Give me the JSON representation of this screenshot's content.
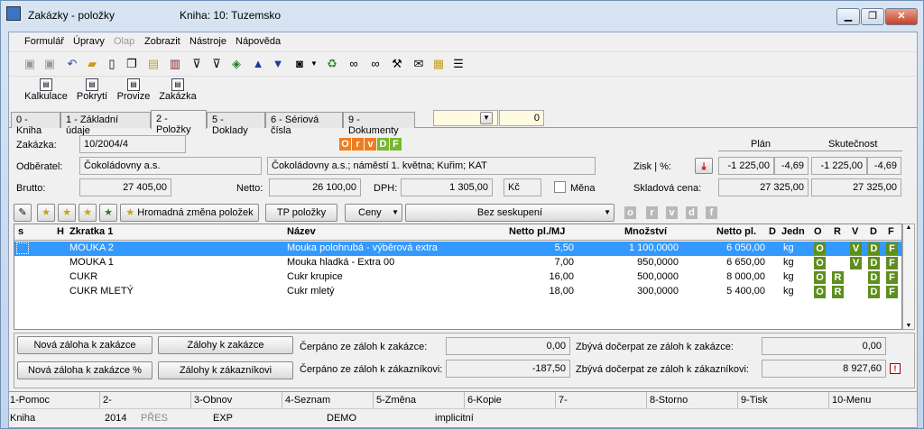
{
  "title": {
    "window": "Zakázky - položky",
    "book": "Kniha: 10: Tuzemsko"
  },
  "window_buttons": {
    "minimize": "▁",
    "restore": "❐",
    "close": "✕"
  },
  "menu": [
    "Formulář",
    "Úpravy",
    "Olap",
    "Zobrazit",
    "Nástroje",
    "Nápověda"
  ],
  "toolbar_icons": [
    "save-icon",
    "save-all-icon",
    "undo-icon",
    "open-folder-icon",
    "new-document-icon",
    "copy-icon",
    "lock-icon",
    "book-icon",
    "filter-icon",
    "filter-edit-icon",
    "layers-icon",
    "arrow-up-icon",
    "arrow-down-icon",
    "camera-icon",
    "dropdown-icon",
    "recycle-icon",
    "binoculars-icon",
    "binoculars-next-icon",
    "tools-icon",
    "mail-icon",
    "clipboard-icon",
    "menu-icon"
  ],
  "actions": [
    "Kalkulace",
    "Pokrytí",
    "Provize",
    "Zakázka"
  ],
  "tabs": [
    "0 - Kniha",
    "1 - Základní údaje",
    "2 - Položky",
    "5 - Doklady",
    "6 - Sériová čísla",
    "9 - Dokumenty"
  ],
  "tabs_extra": {
    "value": "0"
  },
  "form": {
    "zakazka_label": "Zakázka:",
    "zakazka": "10/2004/4",
    "odberatel_label": "Odběratel:",
    "odberatel": "Čokoládovny a.s.",
    "odberatel_address": "Čokoládovny a.s.; náměstí 1. května; Kuřim; KAT",
    "brutto_label": "Brutto:",
    "brutto": "27 405,00",
    "netto_label": "Netto:",
    "netto": "26 100,00",
    "dph_label": "DPH:",
    "dph": "1 305,00",
    "mena_code": "Kč",
    "mena_label": "Měna",
    "plan_label": "Plán",
    "skutecnost_label": "Skutečnost",
    "zisk_label": "Zisk | %:",
    "zisk_plan": "-1 225,00",
    "zisk_plan_pct": "-4,69",
    "zisk_skut": "-1 225,00",
    "zisk_skut_pct": "-4,69",
    "skladova_label": "Skladová cena:",
    "skladova_plan": "27 325,00",
    "skladova_skut": "27 325,00"
  },
  "flags": [
    {
      "letter": "O",
      "color": "#f07e1d"
    },
    {
      "letter": "r",
      "color": "#f07e1d"
    },
    {
      "letter": "v",
      "color": "#f07e1d"
    },
    {
      "letter": "D",
      "color": "#7bb631"
    },
    {
      "letter": "F",
      "color": "#7bb631"
    }
  ],
  "grid_toolbar": {
    "bulk": "Hromadná změna položek",
    "tp": "TP položky",
    "ceny": "Ceny",
    "grouping": "Bez seskupení",
    "letters": [
      "o",
      "r",
      "v",
      "d",
      "f"
    ]
  },
  "grid": {
    "columns": [
      "s",
      "H",
      "Zkratka 1",
      "Název",
      "Netto pl./MJ",
      "Množství",
      "Netto pl.",
      "D",
      "Jedn",
      "O",
      "R",
      "V",
      "D",
      "F"
    ],
    "rows": [
      {
        "zkratka": "MOUKA 2",
        "nazev": "Mouka polohrubá - výběrová extra",
        "netto_mj": "5,50",
        "mnozstvi": "1 100,0000",
        "netto": "6 050,00",
        "jedn": "kg",
        "flags": [
          "O",
          "",
          "V",
          "D",
          "F"
        ]
      },
      {
        "zkratka": "MOUKA 1",
        "nazev": "Mouka hladká - Extra 00",
        "netto_mj": "7,00",
        "mnozstvi": "950,0000",
        "netto": "6 650,00",
        "jedn": "kg",
        "flags": [
          "O",
          "",
          "V",
          "D",
          "F"
        ]
      },
      {
        "zkratka": "CUKR",
        "nazev": "Cukr krupice",
        "netto_mj": "16,00",
        "mnozstvi": "500,0000",
        "netto": "8 000,00",
        "jedn": "kg",
        "flags": [
          "O",
          "R",
          "",
          "D",
          "F"
        ]
      },
      {
        "zkratka": "CUKR MLETÝ",
        "nazev": "Cukr mletý",
        "netto_mj": "18,00",
        "mnozstvi": "300,0000",
        "netto": "5 400,00",
        "jedn": "kg",
        "flags": [
          "O",
          "R",
          "",
          "D",
          "F"
        ]
      }
    ]
  },
  "advances": {
    "btn1": "Nová záloha k zakázce",
    "btn2": "Zálohy k zakázce",
    "btn3": "Nová záloha k zakázce %",
    "btn4": "Zálohy k zákazníkovi",
    "l1": "Čerpáno ze záloh k zakázce:",
    "v1": "0,00",
    "l2": "Zbývá dočerpat ze záloh k zakázce:",
    "v2": "0,00",
    "l3": "Čerpáno ze záloh k zákazníkovi:",
    "v3": "-187,50",
    "l4": "Zbývá dočerpat ze záloh k zákazníkovi:",
    "v4": "8 927,60"
  },
  "fkeys": [
    "1-Pomoc",
    "2-",
    "3-Obnov",
    "4-Seznam",
    "5-Změna",
    "6-Kopie",
    "7-",
    "8-Storno",
    "9-Tisk",
    "10-Menu"
  ],
  "statusbar": [
    "Kniha",
    "2014",
    "PŘES",
    "EXP",
    "DEMO",
    "implicitní"
  ]
}
